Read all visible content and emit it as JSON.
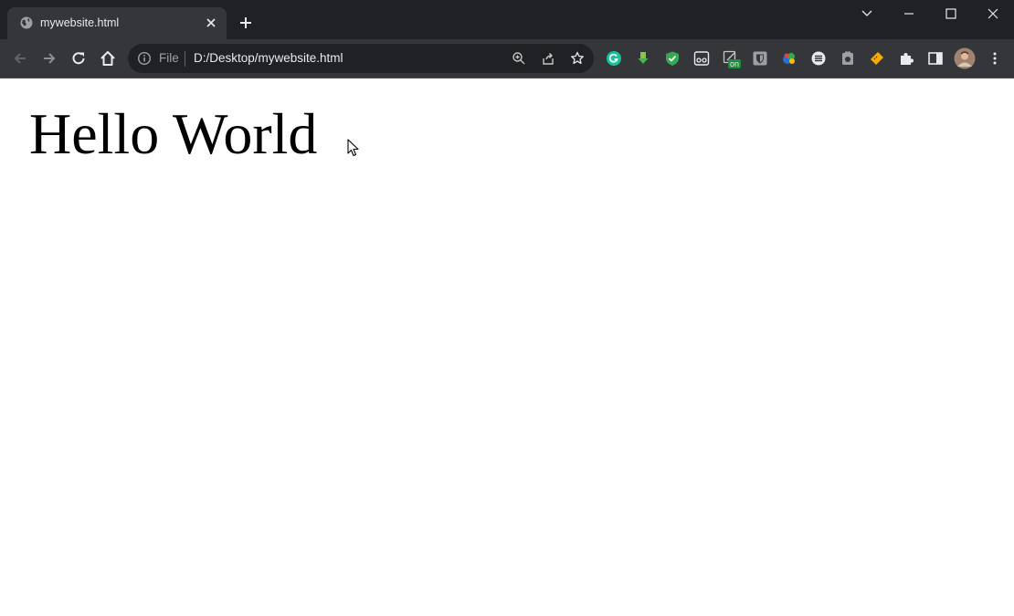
{
  "browser": {
    "tab": {
      "title": "mywebsite.html",
      "favicon": "globe-icon"
    },
    "address_bar": {
      "security_label": "File",
      "url": "D:/Desktop/mywebsite.html"
    },
    "extensions": [
      "grammarly-icon",
      "download-arrow-icon",
      "shield-check-icon",
      "glasses-icon",
      "toggle-on-icon",
      "bitwarden-icon",
      "colorful-leaf-icon",
      "lines-circle-icon",
      "camera-icon",
      "ticket-icon",
      "puzzle-icon",
      "side-panel-icon",
      "avatar"
    ],
    "toggle_badge": "on",
    "colors": {
      "tab_strip": "#202124",
      "toolbar": "#35363a",
      "omnibox": "#202124",
      "accent_green": "#1e8e3e"
    }
  },
  "page": {
    "heading": "Hello World"
  }
}
